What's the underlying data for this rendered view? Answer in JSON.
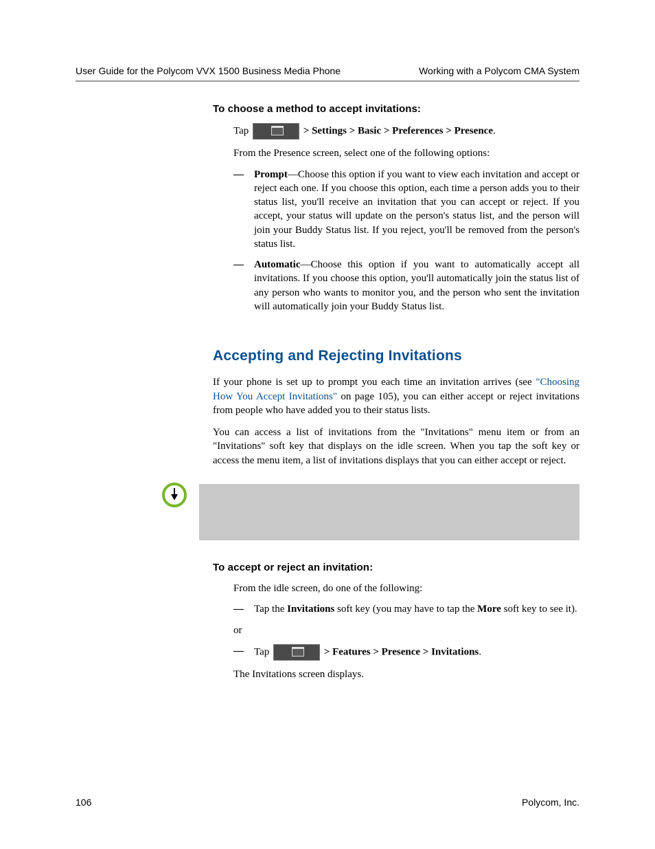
{
  "header": {
    "left": "User Guide for the Polycom VVX 1500 Business Media Phone",
    "right": "Working with a Polycom CMA System"
  },
  "section1": {
    "title": "To choose a method to accept invitations:",
    "tap_prefix": "Tap ",
    "tap_path": " > Settings > Basic > Preferences > Presence",
    "tap_period": ".",
    "line2": "From the Presence screen, select one of the following options:",
    "bullets": [
      {
        "lead": "Prompt",
        "text": "—Choose this option if you want to view each invitation and accept or reject each one. If you choose this option, each time a person adds you to their status list, you'll receive an invitation that you can accept or reject. If you accept, your status will update on the person's status list, and the person will join your Buddy Status list. If you reject, you'll be removed from the person's status list."
      },
      {
        "lead": "Automatic",
        "text": "—Choose this option if you want to automatically accept all invitations. If you choose this option, you'll automatically join the status list of any person who wants to monitor you, and the person who sent the invitation will automatically join your Buddy Status list."
      }
    ]
  },
  "section2": {
    "heading": "Accepting and Rejecting Invitations",
    "p1_a": "If your phone is set up to prompt you each time an invitation arrives (see ",
    "p1_link": "\"Choosing How You Accept Invitations\"",
    "p1_b": " on page 105), you can either accept or reject invitations from people who have added you to their status lists.",
    "p2": "You can access a list of invitations from the \"Invitations\" menu item or from an \"Invitations\" soft key that displays on the idle screen. When you tap the soft key or access the menu item, a list of invitations displays that you can either accept or reject."
  },
  "section3": {
    "title": "To accept or reject an invitation:",
    "line1": "From the idle screen, do one of the following:",
    "bullet1_a": "Tap the ",
    "bullet1_b": "Invitations",
    "bullet1_c": " soft key (you may have to tap the ",
    "bullet1_d": "More",
    "bullet1_e": " soft key to see it).",
    "or": "or",
    "bullet2_prefix": "Tap ",
    "bullet2_path": " > Features > Presence > Invitations",
    "bullet2_period": ".",
    "line_end": "The Invitations screen displays."
  },
  "footer": {
    "page": "106",
    "company": "Polycom, Inc."
  }
}
